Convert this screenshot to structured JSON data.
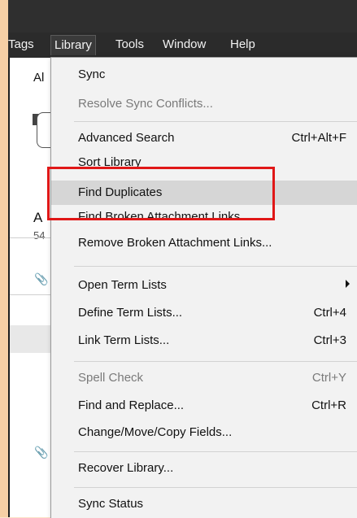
{
  "menubar": {
    "items": [
      "Tags",
      "Library",
      "Tools",
      "Window",
      "Help"
    ]
  },
  "background": {
    "text_al": "Al",
    "text_a": "A",
    "text_54": "54"
  },
  "library_menu": {
    "items": [
      {
        "label": "Sync",
        "shortcut": "",
        "disabled": false
      },
      {
        "label": "Resolve Sync Conflicts...",
        "shortcut": "",
        "disabled": true
      },
      {
        "label": "Advanced Search",
        "shortcut": "Ctrl+Alt+F",
        "disabled": false
      },
      {
        "label": "Sort Library",
        "shortcut": "",
        "disabled": false
      },
      {
        "label": "Find Duplicates",
        "shortcut": "",
        "disabled": false,
        "hover": true
      },
      {
        "label": "Find Broken Attachment Links",
        "shortcut": "",
        "disabled": false
      },
      {
        "label": "Remove Broken Attachment Links...",
        "shortcut": "",
        "disabled": false
      },
      {
        "label": "Open Term Lists",
        "shortcut": "",
        "disabled": false,
        "submenu": true
      },
      {
        "label": "Define Term Lists...",
        "shortcut": "Ctrl+4",
        "disabled": false
      },
      {
        "label": "Link Term Lists...",
        "shortcut": "Ctrl+3",
        "disabled": false
      },
      {
        "label": "Spell Check",
        "shortcut": "Ctrl+Y",
        "disabled": true
      },
      {
        "label": "Find and Replace...",
        "shortcut": "Ctrl+R",
        "disabled": false
      },
      {
        "label": "Change/Move/Copy Fields...",
        "shortcut": "",
        "disabled": false
      },
      {
        "label": "Recover Library...",
        "shortcut": "",
        "disabled": false
      },
      {
        "label": "Sync Status",
        "shortcut": "",
        "disabled": false
      }
    ]
  },
  "colors": {
    "highlight": "#e01717",
    "menu_bg": "#f2f2f2",
    "menubar_bg": "#2b2b2b"
  },
  "icons": [
    "paperclip-icon",
    "chevron-right-icon"
  ]
}
